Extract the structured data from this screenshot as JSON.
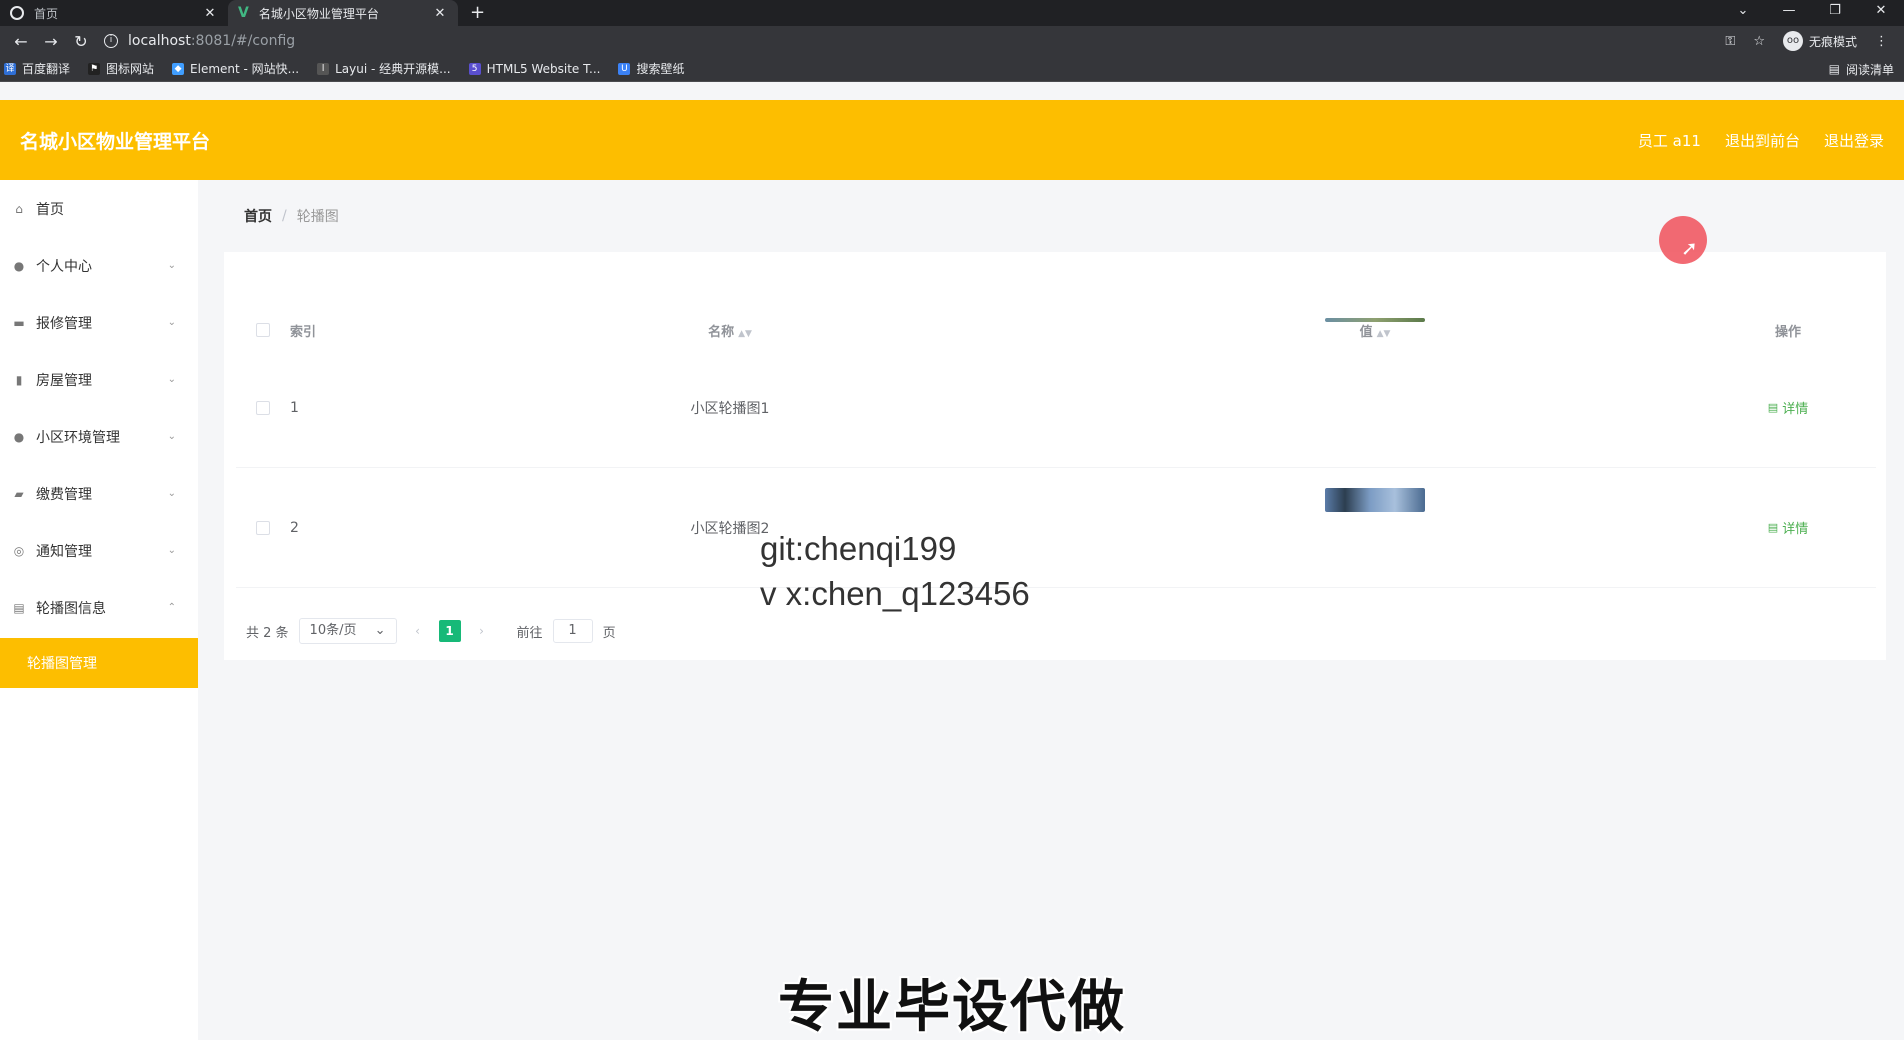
{
  "browser": {
    "tabs": [
      {
        "title": "首页",
        "active": false
      },
      {
        "title": "名城小区物业管理平台",
        "active": true
      }
    ],
    "new_tab": "+",
    "url_host": "localhost",
    "url_path": ":8081/#/config",
    "incognito_label": "无痕模式",
    "bookmarks": [
      {
        "label": "百度翻译",
        "icon": "translate-icon",
        "color": "#2f6fd6"
      },
      {
        "label": "图标网站",
        "icon": "flag-icon",
        "color": "#444"
      },
      {
        "label": "Element - 网站快...",
        "icon": "element-icon",
        "color": "#409eff"
      },
      {
        "label": "Layui - 经典开源模...",
        "icon": "layui-icon",
        "color": "#555"
      },
      {
        "label": "HTML5 Website T...",
        "icon": "html5-icon",
        "color": "#5a4fcf"
      },
      {
        "label": "搜索壁纸",
        "icon": "wallpaper-icon",
        "color": "#3b82f6"
      }
    ],
    "reading_list": "阅读清单"
  },
  "header": {
    "title": "名城小区物业管理平台",
    "links": [
      "员工 a11",
      "退出到前台",
      "退出登录"
    ],
    "color": "#fdbe00"
  },
  "sidebar": {
    "items": [
      {
        "label": "首页",
        "icon": "home-icon",
        "glyph": "⌂",
        "chevron": false
      },
      {
        "label": "个人中心",
        "icon": "user-icon",
        "glyph": "●",
        "chevron": true
      },
      {
        "label": "报修管理",
        "icon": "wrench-icon",
        "glyph": "▬",
        "chevron": true
      },
      {
        "label": "房屋管理",
        "icon": "building-icon",
        "glyph": "▮",
        "chevron": true
      },
      {
        "label": "小区环境管理",
        "icon": "person-icon",
        "glyph": "●",
        "chevron": true
      },
      {
        "label": "缴费管理",
        "icon": "wallet-icon",
        "glyph": "▰",
        "chevron": true
      },
      {
        "label": "通知管理",
        "icon": "compass-icon",
        "glyph": "◎",
        "chevron": true
      },
      {
        "label": "轮播图信息",
        "icon": "document-icon",
        "glyph": "▤",
        "chevron": true,
        "expanded": true
      }
    ],
    "active_sub": "轮播图管理"
  },
  "breadcrumb": {
    "home": "首页",
    "separator": "/",
    "current": "轮播图"
  },
  "table": {
    "headers": {
      "index": "索引",
      "name": "名称",
      "value": "值",
      "action": "操作"
    },
    "rows": [
      {
        "index": "1",
        "name": "小区轮播图1",
        "action": "详情"
      },
      {
        "index": "2",
        "name": "小区轮播图2",
        "action": "详情"
      }
    ]
  },
  "pagination": {
    "total": "共 2 条",
    "page_size": "10条/页",
    "current_page": "1",
    "goto_label": "前往",
    "goto_value": "1",
    "page_suffix": "页"
  },
  "overlay": {
    "watermark_line1": "git:chenqi199",
    "watermark_line2": "v x:chen_q123456",
    "caption": "专业毕设代做"
  }
}
